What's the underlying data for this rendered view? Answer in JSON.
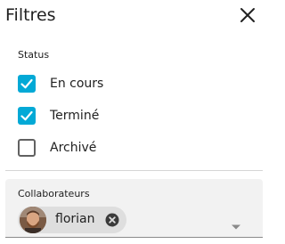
{
  "header": {
    "title": "Filtres",
    "close_icon": "close-icon"
  },
  "status": {
    "heading": "Status",
    "options": [
      {
        "label": "En cours",
        "checked": true
      },
      {
        "label": "Terminé",
        "checked": true
      },
      {
        "label": "Archivé",
        "checked": false
      }
    ]
  },
  "collaborators": {
    "label": "Collaborateurs",
    "chips": [
      {
        "name": "florian",
        "avatar": "user-avatar"
      }
    ],
    "dropdown_icon": "dropdown-arrow-icon"
  },
  "colors": {
    "accent": "#03a9d6",
    "field_background": "#f2f2f2",
    "chip_background": "#dedede"
  }
}
